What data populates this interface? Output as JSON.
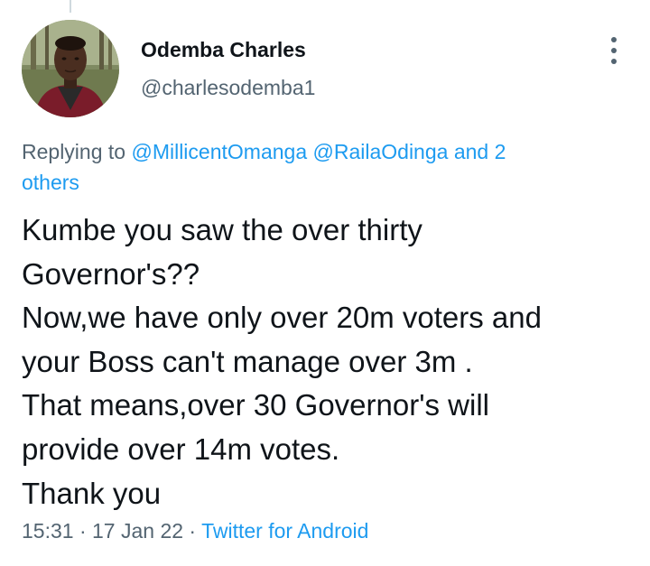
{
  "tweet": {
    "author": {
      "display_name": "Odemba Charles",
      "handle": "@charlesodemba1",
      "avatar_icon": "person-avatar-photo"
    },
    "more_icon": "more-vertical-icon",
    "replying": {
      "prefix": "Replying to ",
      "mention_1": "@MillicentOmanga",
      "mention_2": "@RailaOdinga",
      "others_line1": "and 2",
      "others_line2": "others"
    },
    "text_lines": [
      "Kumbe you saw the over thirty",
      "Governor's??",
      "Now,we have only over 20m voters and",
      "your Boss can't manage over 3m .",
      "That means,over 30 Governor's will",
      "provide over 14m votes.",
      "Thank you"
    ],
    "time": "15:31",
    "date": "17 Jan 22",
    "separator": " · ",
    "source": "Twitter for Android"
  },
  "colors": {
    "primary_text": "#0f1419",
    "secondary_text": "#536471",
    "link": "#1d9bf0",
    "thread_line": "#cfd9de"
  }
}
